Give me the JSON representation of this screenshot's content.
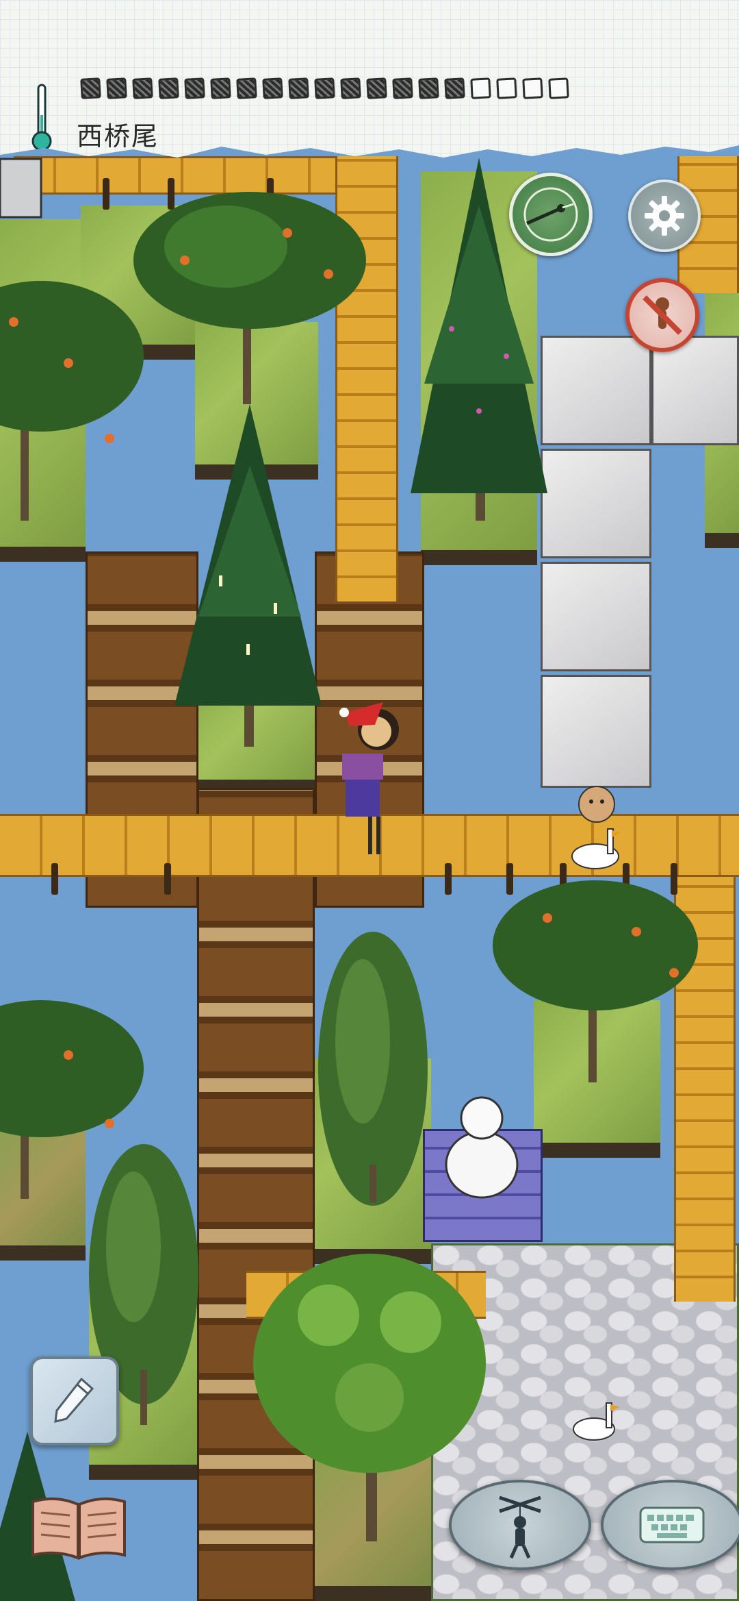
{
  "header": {
    "location_name": "西桥尾",
    "food_pips": {
      "filled": 15,
      "total": 19
    }
  },
  "colors": {
    "water": "#6f9fd0",
    "grass": "#9bbd56",
    "plank": "#e3a935",
    "stone": "#d8d8dc",
    "warning_red": "#c64432",
    "compass_green": "#4f8a52"
  },
  "icons": {
    "thermometer": "thermometer-icon",
    "compass": "compass-icon",
    "settings": "gear-icon",
    "no_goose": "no-goose-icon",
    "pencil": "pencil-icon",
    "book": "open-book-icon",
    "puppet": "puppet-icon",
    "keyboard": "keyboard-icon"
  },
  "player": {
    "hat": "santa-hat"
  }
}
